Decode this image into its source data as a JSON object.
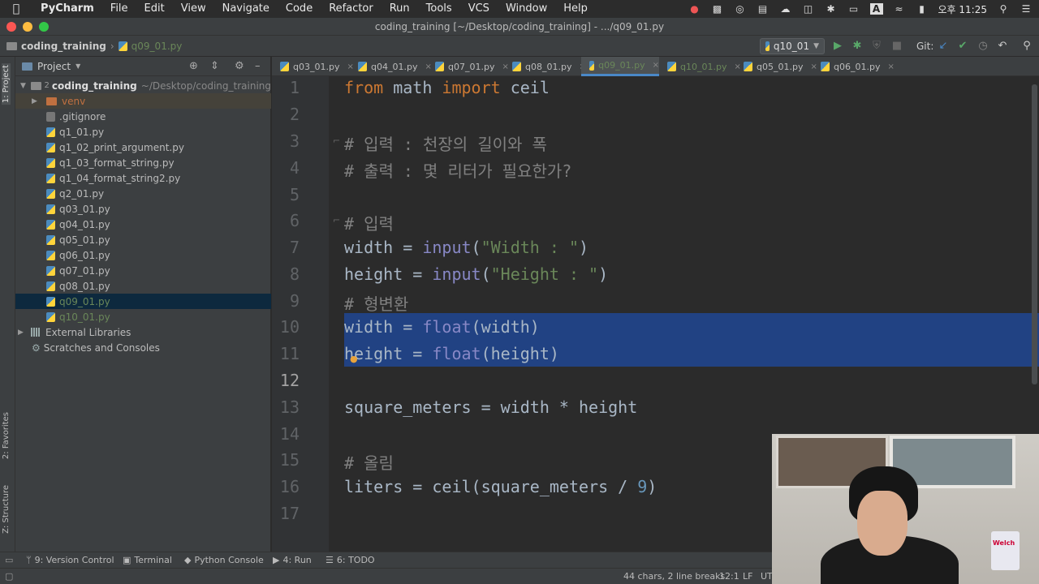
{
  "menubar": {
    "app_name": "PyCharm",
    "items": [
      "File",
      "Edit",
      "View",
      "Navigate",
      "Code",
      "Refactor",
      "Run",
      "Tools",
      "VCS",
      "Window",
      "Help"
    ],
    "clock": "오후 11:25"
  },
  "window": {
    "title": "coding_training [~/Desktop/coding_training] - .../q09_01.py"
  },
  "navbar": {
    "project_crumb": "coding_training",
    "file_crumb": "q09_01.py",
    "run_config": "q10_01",
    "git_label": "Git:"
  },
  "project_panel": {
    "title": "Project",
    "root_name": "coding_training",
    "root_path": "~/Desktop/coding_training",
    "root_marker": "2",
    "venv": "venv",
    "files": [
      ".gitignore",
      "q1_01.py",
      "q1_02_print_argument.py",
      "q1_03_format_string.py",
      "q1_04_format_string2.py",
      "q2_01.py",
      "q03_01.py",
      "q04_01.py",
      "q05_01.py",
      "q06_01.py",
      "q07_01.py",
      "q08_01.py",
      "q09_01.py",
      "q10_01.py"
    ],
    "external_libraries": "External Libraries",
    "scratches": "Scratches and Consoles"
  },
  "tabs": [
    "q03_01.py",
    "q04_01.py",
    "q07_01.py",
    "q08_01.py",
    "q09_01.py",
    "q10_01.py",
    "q05_01.py",
    "q06_01.py"
  ],
  "editor": {
    "line_numbers": [
      "1",
      "2",
      "3",
      "4",
      "5",
      "6",
      "7",
      "8",
      "9",
      "10",
      "11",
      "12",
      "13",
      "14",
      "15",
      "16",
      "17"
    ],
    "lines": [
      "from math import ceil",
      "",
      "# 입력 : 천장의 길이와 폭",
      "# 출력 : 몇 리터가 필요한가?",
      "",
      "# 입력",
      "width = input(\"Width : \")",
      "height = input(\"Height : \")",
      "# 형변환",
      "width = float(width)",
      "height = float(height)",
      "",
      "square_meters = width * height",
      "",
      "# 올림",
      "liters = ceil(square_meters / 9)",
      ""
    ]
  },
  "left_stripe": {
    "project_tab": "1: Project",
    "favorites_tab": "2: Favorites",
    "structure_tab": "Z: Structure"
  },
  "bottom_tools": [
    "9: Version Control",
    "Terminal",
    "Python Console",
    "4: Run",
    "6: TODO"
  ],
  "status": {
    "selection_info": "44 chars, 2 line breaks",
    "caret": "12:1",
    "line_sep": "LF",
    "encoding": "UT"
  },
  "webcam": {
    "can_label": "Welch"
  }
}
